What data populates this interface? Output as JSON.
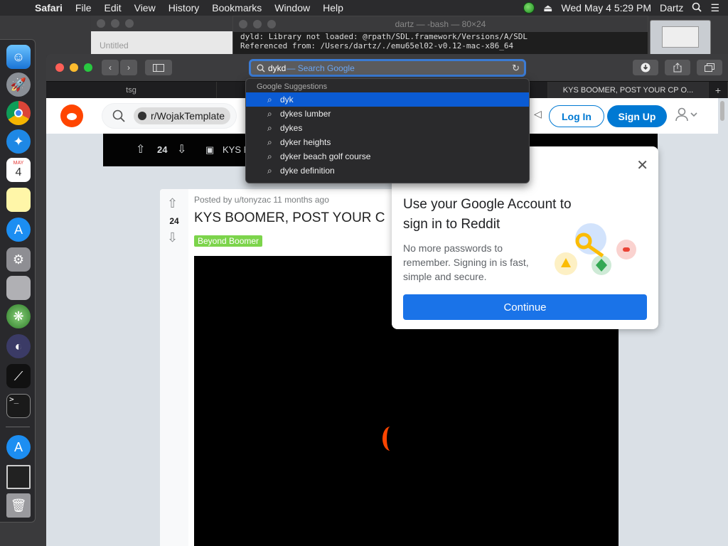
{
  "menubar": {
    "apple": "",
    "items": [
      "Safari",
      "File",
      "Edit",
      "View",
      "History",
      "Bookmarks",
      "Window",
      "Help"
    ],
    "datetime": "Wed May 4  5:29 PM",
    "user": "Dartz"
  },
  "bg_windows": {
    "untitled_title": "Untitled",
    "terminal_title": "dartz — -bash — 80×24",
    "terminal_lines": [
      "dyld: Library not loaded: @rpath/SDL.framework/Versions/A/SDL",
      "  Referenced from: /Users/dartz/./emu65el02-v0.12-mac-x86_64"
    ]
  },
  "dock": {
    "calendar_month": "MAY",
    "calendar_day": "4"
  },
  "safari": {
    "address": {
      "typed": "dykd",
      "hint": "— Search Google"
    },
    "tabs": [
      "tsg",
      "KYS BOOMER, POST YOUR CP O..."
    ],
    "suggestions": {
      "header": "Google Suggestions",
      "items": [
        "dyk",
        "dykes lumber",
        "dykes",
        "dyker heights",
        "dyker beach golf course",
        "dyke definition"
      ],
      "selected_index": 0
    }
  },
  "reddit": {
    "subreddit": "r/WojakTemplate",
    "login": "Log In",
    "signup": "Sign Up",
    "postbar_votes": "24",
    "postbar_title": "KYS B",
    "post": {
      "meta": "Posted by u/tonyzac 11 months ago",
      "votes": "24",
      "title": "KYS BOOMER, POST YOUR CP O",
      "flair": "Beyond Boomer"
    }
  },
  "google_popup": {
    "heading": "Use your Google Account to sign in to Reddit",
    "description": "No more passwords to remember. Signing in is fast, simple and secure.",
    "continue": "Continue"
  },
  "colors": {
    "accent_blue": "#0079d3",
    "google_blue": "#1a73e8",
    "reddit_orange": "#ff4500",
    "selection_blue": "#0b5bd3"
  }
}
